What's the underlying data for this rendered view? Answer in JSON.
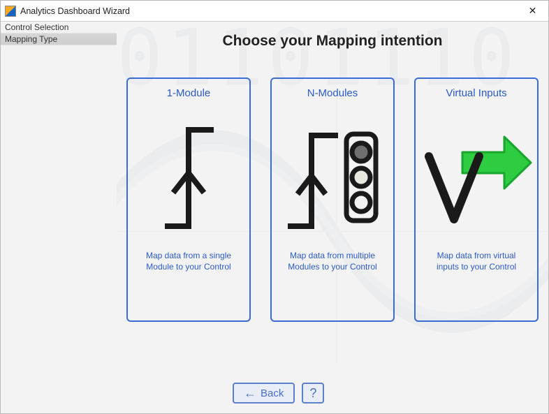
{
  "window": {
    "title": "Analytics Dashboard Wizard"
  },
  "sidebar": {
    "items": [
      {
        "label": "Control Selection",
        "selected": false
      },
      {
        "label": "Mapping Type",
        "selected": true
      }
    ]
  },
  "main": {
    "heading": "Choose your Mapping intention",
    "cards": [
      {
        "title": "1-Module",
        "desc": "Map data from a single Module to your Control",
        "icon": "one-module-icon"
      },
      {
        "title": "N-Modules",
        "desc": "Map data from multiple Modules to your Control",
        "icon": "n-modules-icon"
      },
      {
        "title": "Virtual Inputs",
        "desc": "Map data from virtual inputs to your Control",
        "icon": "virtual-inputs-icon"
      }
    ]
  },
  "footer": {
    "back_label": "Back",
    "help_label": "?"
  },
  "colors": {
    "accent": "#3b6bd6",
    "icon_stroke": "#1a1a1a",
    "arrow_fill": "#2ecc40"
  }
}
